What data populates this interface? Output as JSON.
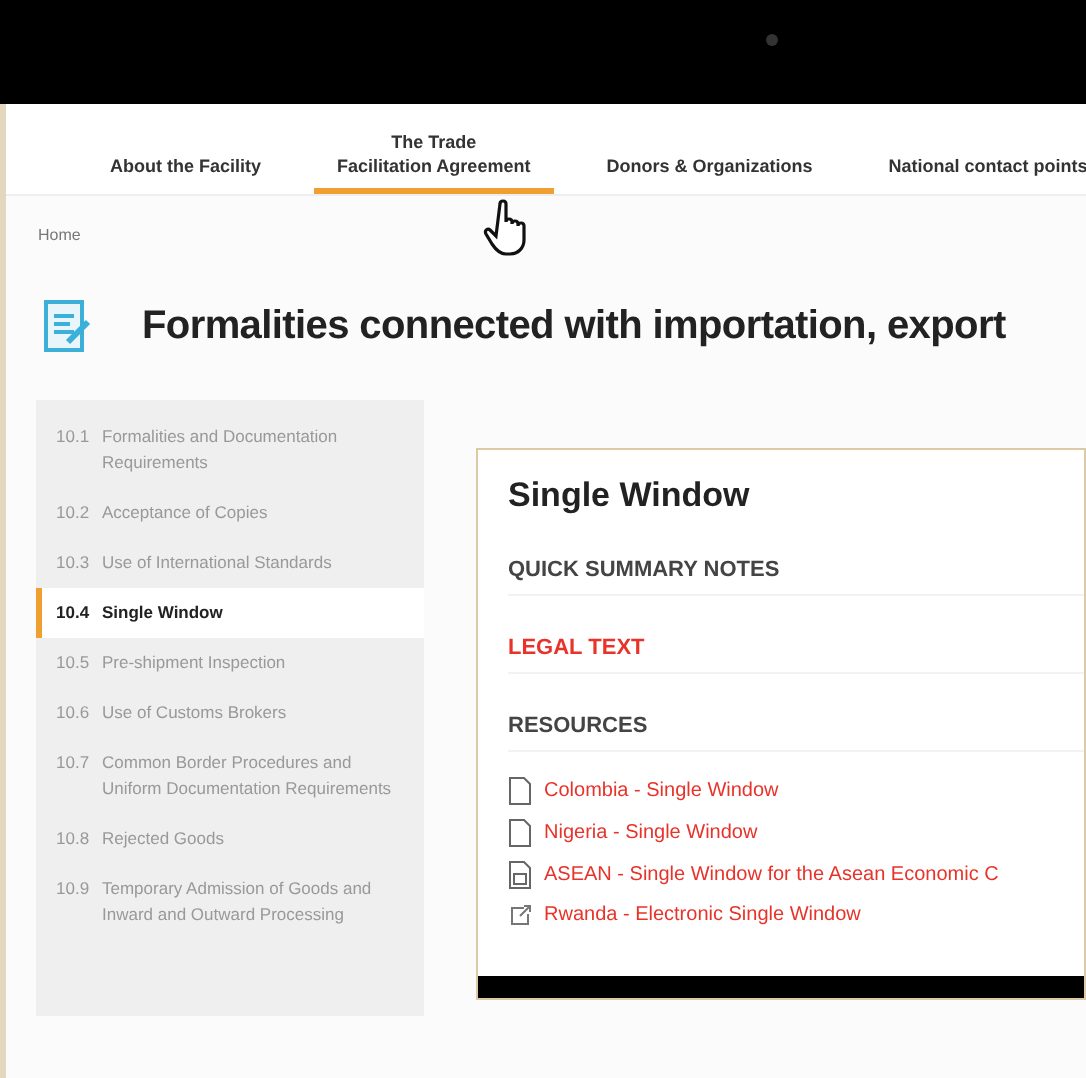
{
  "nav": [
    {
      "label": "About the Facility",
      "selected": false
    },
    {
      "label": "The Trade\nFacilitation Agreement",
      "selected": true
    },
    {
      "label": "Donors & Organizations",
      "selected": false
    },
    {
      "label": "National contact points",
      "selected": false
    }
  ],
  "breadcrumb": "Home",
  "page_title": "Formalities connected with importation, export",
  "sidebar": {
    "items": [
      {
        "number": "10.1",
        "label": "Formalities and Documentation Requirements",
        "selected": false
      },
      {
        "number": "10.2",
        "label": "Acceptance of Copies",
        "selected": false
      },
      {
        "number": "10.3",
        "label": "Use of International Standards",
        "selected": false
      },
      {
        "number": "10.4",
        "label": "Single Window",
        "selected": true
      },
      {
        "number": "10.5",
        "label": "Pre-shipment Inspection",
        "selected": false
      },
      {
        "number": "10.6",
        "label": "Use of Customs Brokers",
        "selected": false
      },
      {
        "number": "10.7",
        "label": "Common Border Procedures and Uniform Documentation Requirements",
        "selected": false
      },
      {
        "number": "10.8",
        "label": "Rejected Goods",
        "selected": false
      },
      {
        "number": "10.9",
        "label": "Temporary Admission of Goods and Inward and Outward Processing",
        "selected": false
      }
    ]
  },
  "panel": {
    "title": "Single Window",
    "sections": [
      {
        "label": "QUICK SUMMARY NOTES",
        "kind": "heading"
      },
      {
        "label": "LEGAL TEXT",
        "kind": "link"
      },
      {
        "label": "RESOURCES",
        "kind": "heading"
      }
    ],
    "resources": [
      {
        "label": "Colombia - Single Window",
        "kind": "file"
      },
      {
        "label": "Nigeria - Single Window",
        "kind": "file"
      },
      {
        "label": "ASEAN - Single Window for the Asean Economic C",
        "kind": "pdf"
      },
      {
        "label": "Rwanda - Electronic Single Window",
        "kind": "link"
      }
    ]
  }
}
